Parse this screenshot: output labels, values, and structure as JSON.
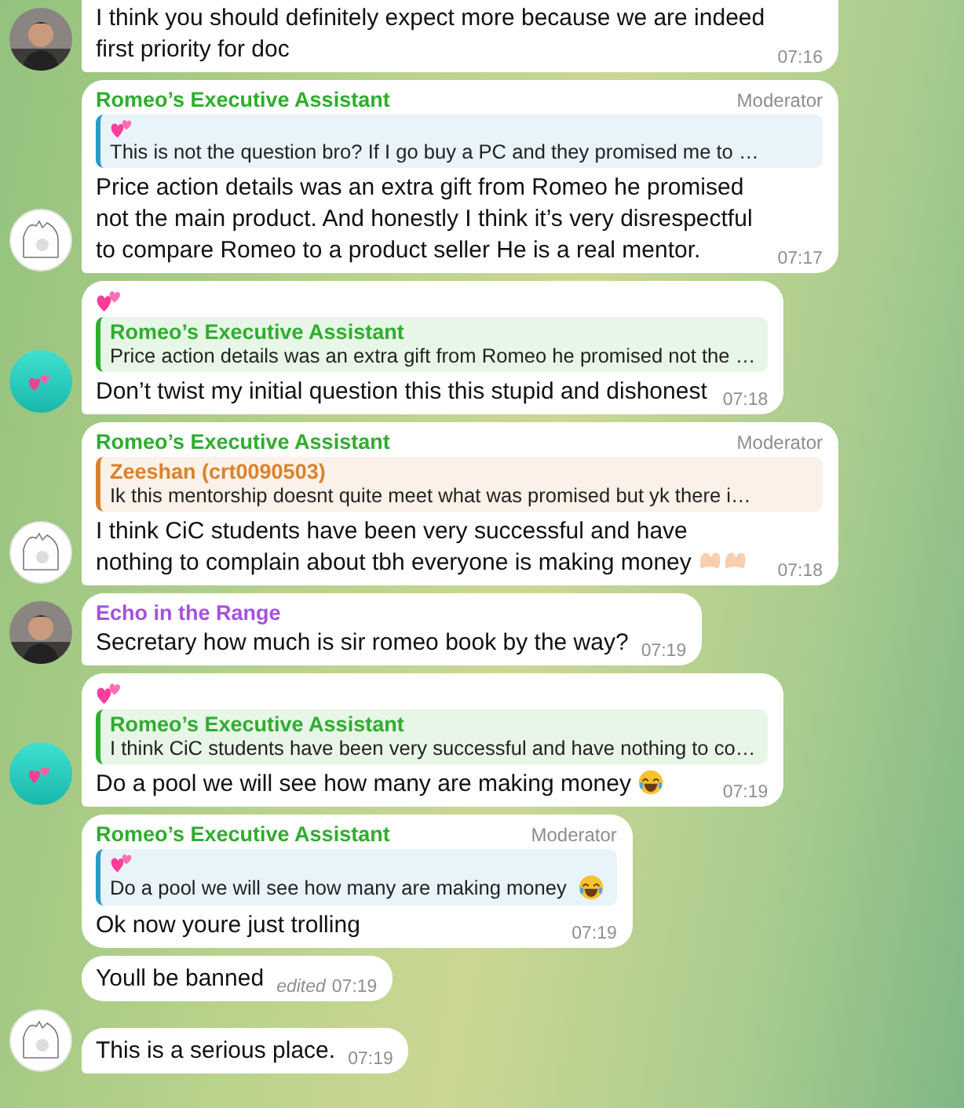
{
  "messages": [
    {
      "text": "I think you should definitely expect more because we are indeed first priority for doc",
      "time": "07:16"
    },
    {
      "avatar": {
        "kind": "sketch"
      },
      "sender": {
        "kind": "text",
        "name": "Romeo’s Executive Assistant",
        "color": "#2fad2f"
      },
      "badge": "Moderator",
      "reply": {
        "sender": {
          "kind": "hearts"
        },
        "color": "#2a9cc8",
        "text": "This is not the question bro? If I go buy a PC and they promised me to …"
      },
      "text": "Price action details was an extra gift from Romeo he promised not the main product.  And honestly I think it’s very disrespectful to compare Romeo to a product seller He is a real mentor.",
      "time": "07:17"
    },
    {
      "avatar": {
        "kind": "hearts"
      },
      "sender": {
        "kind": "hearts"
      },
      "reply": {
        "sender": {
          "kind": "text",
          "name": "Romeo’s Executive Assistant",
          "color": "#2fad2f"
        },
        "color": "#2fad2f",
        "text": "Price action details was an extra gift from Romeo he promised not the …"
      },
      "text": "Don’t twist my initial question this this stupid and dishonest",
      "time": "07:18"
    },
    {
      "avatar": {
        "kind": "sketch"
      },
      "sender": {
        "kind": "text",
        "name": "Romeo’s Executive Assistant",
        "color": "#2fad2f"
      },
      "badge": "Moderator",
      "reply": {
        "sender": {
          "kind": "text",
          "name": "Zeeshan (crt0090503)",
          "color": "#d9822b"
        },
        "color": "#d9822b",
        "text": "Ik this mentorship doesnt quite meet what was promised but yk there i…"
      },
      "text": "I think CiC students have been very successful and have nothing to complain about tbh everyone is making money",
      "emoji": {
        "kind": "heart-hands"
      },
      "time": "07:18"
    },
    {
      "sender": {
        "kind": "text",
        "name": "Echo in the Range",
        "color": "#a552dd"
      },
      "text": "Secretary how much is sir romeo book by the way?",
      "time": "07:19"
    },
    {
      "avatar": {
        "kind": "hearts"
      },
      "sender": {
        "kind": "hearts"
      },
      "reply": {
        "sender": {
          "kind": "text",
          "name": "Romeo’s Executive Assistant",
          "color": "#2fad2f"
        },
        "color": "#2fad2f",
        "text": "I think CiC students have been very successful and have nothing to co…"
      },
      "text": "Do a pool we will see how many are making money",
      "emoji": {
        "kind": "laughing"
      },
      "time": "07:19"
    },
    {
      "sender": {
        "kind": "text",
        "name": "Romeo’s Executive Assistant",
        "color": "#2fad2f"
      },
      "badge": "Moderator",
      "reply": {
        "sender": {
          "kind": "hearts"
        },
        "color": "#2a9cc8",
        "text": "Do a pool we will see how many are making money",
        "emoji": {
          "kind": "laughing"
        }
      },
      "text": "Ok now youre just trolling",
      "time": "07:19"
    },
    {
      "text": "Youll be banned",
      "edited": "edited",
      "time": "07:19"
    },
    {
      "avatar": {
        "kind": "sketch"
      },
      "text": "This is a serious place.",
      "time": "07:19"
    }
  ]
}
